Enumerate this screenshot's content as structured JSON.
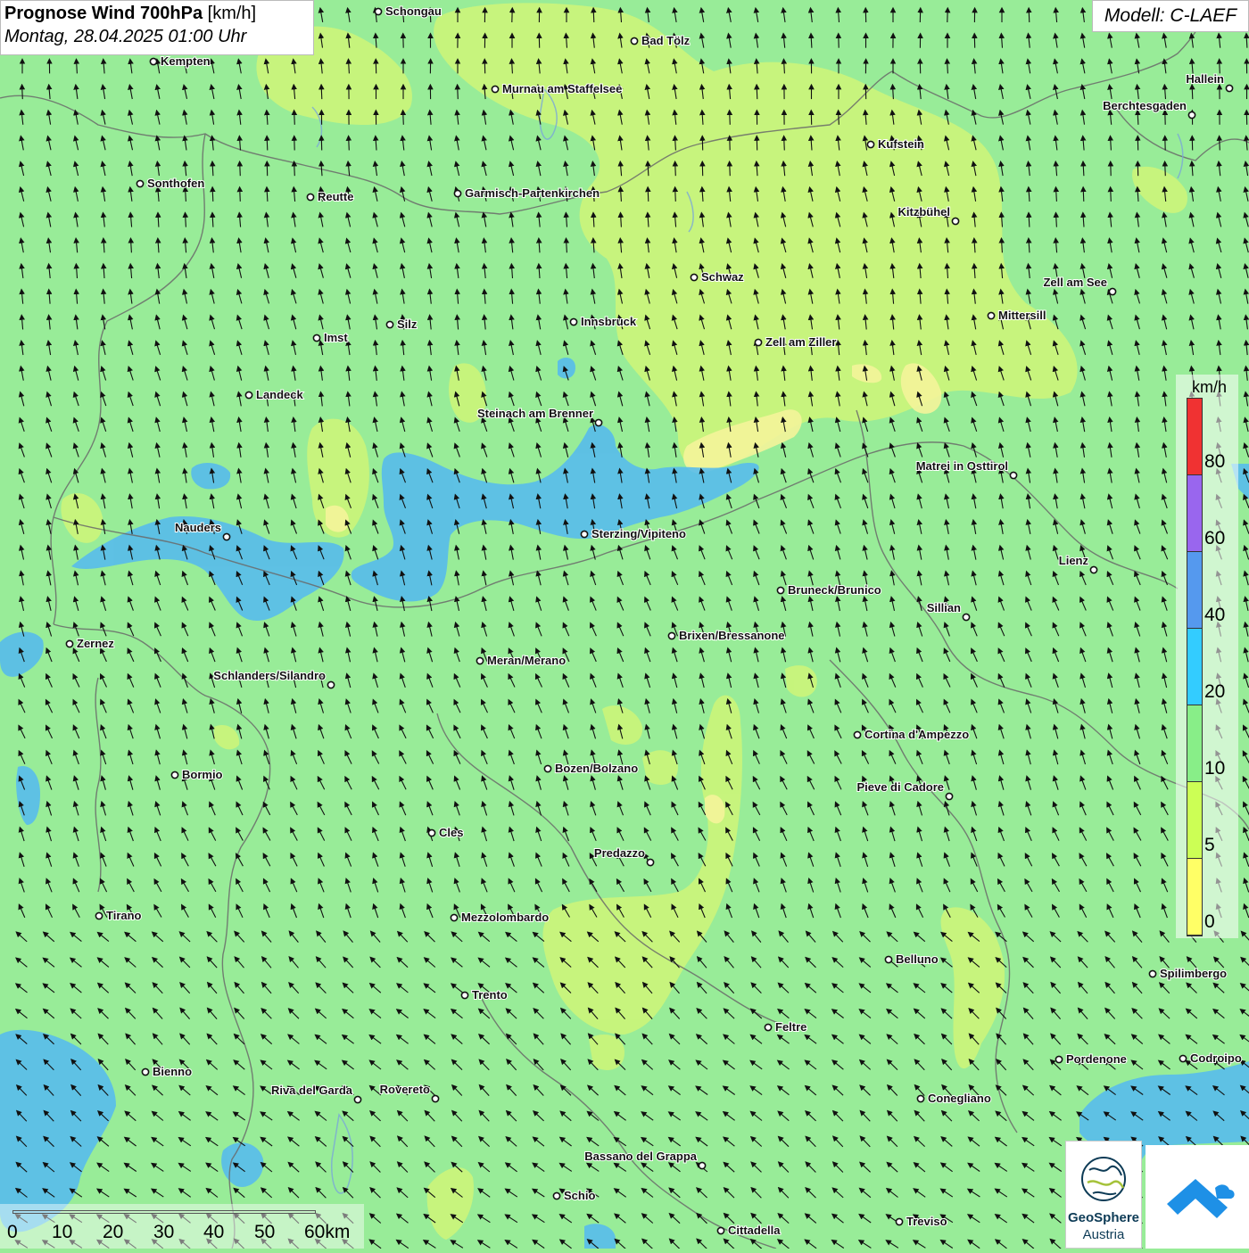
{
  "title": {
    "main": "Prognose Wind 700hPa",
    "unit": "[km/h]",
    "date": "Montag, 28.04.2025 01:00 Uhr"
  },
  "model": "Modell: C-LAEF",
  "legend": {
    "unit": "km/h",
    "levels": [
      {
        "label": "80",
        "color": "#f03232"
      },
      {
        "label": "60",
        "color": "#9966ee"
      },
      {
        "label": "40",
        "color": "#5599ee"
      },
      {
        "label": "20",
        "color": "#33ccff"
      },
      {
        "label": "10",
        "color": "#88ee88"
      },
      {
        "label": "5",
        "color": "#ccff55"
      },
      {
        "label": "0",
        "color": "#ffff66"
      }
    ]
  },
  "scalebar": {
    "labels": [
      "0",
      "10",
      "20",
      "30",
      "40",
      "50",
      "60km"
    ]
  },
  "logos": {
    "geosphere_line1": "GeoSphere",
    "geosphere_line2": "Austria"
  },
  "cities": [
    {
      "name": "Schongau"
    },
    {
      "name": "Bad Tölz"
    },
    {
      "name": "Kempten"
    },
    {
      "name": "Murnau am Staffelsee"
    },
    {
      "name": "Hallein"
    },
    {
      "name": "Berchtesgaden"
    },
    {
      "name": "Kufstein"
    },
    {
      "name": "Sonthofen"
    },
    {
      "name": "Reutte"
    },
    {
      "name": "Garmisch-Partenkirchen"
    },
    {
      "name": "Kitzbühel"
    },
    {
      "name": "Schwaz"
    },
    {
      "name": "Zell am See"
    },
    {
      "name": "Mittersill"
    },
    {
      "name": "Silz"
    },
    {
      "name": "Innsbruck"
    },
    {
      "name": "Imst"
    },
    {
      "name": "Zell am Ziller"
    },
    {
      "name": "Landeck"
    },
    {
      "name": "Steinach am Brenner"
    },
    {
      "name": "Matrei in Osttirol"
    },
    {
      "name": "Nauders"
    },
    {
      "name": "Sterzing/Vipiteno"
    },
    {
      "name": "Lienz"
    },
    {
      "name": "Bruneck/Brunico"
    },
    {
      "name": "Sillian"
    },
    {
      "name": "Zernez"
    },
    {
      "name": "Brixen/Bressanone"
    },
    {
      "name": "Meran/Merano"
    },
    {
      "name": "Schlanders/Silandro"
    },
    {
      "name": "Cortina d'Ampezzo"
    },
    {
      "name": "Bozen/Bolzano"
    },
    {
      "name": "Bormio"
    },
    {
      "name": "Pieve di Cadore"
    },
    {
      "name": "Cles"
    },
    {
      "name": "Predazzo"
    },
    {
      "name": "Tirano"
    },
    {
      "name": "Mezzolombardo"
    },
    {
      "name": "Belluno"
    },
    {
      "name": "Spilimbergo"
    },
    {
      "name": "Trento"
    },
    {
      "name": "Feltre"
    },
    {
      "name": "Pordenone"
    },
    {
      "name": "Codroipo"
    },
    {
      "name": "Bienno"
    },
    {
      "name": "Riva del Garda"
    },
    {
      "name": "Rovereto"
    },
    {
      "name": "Conegliano"
    },
    {
      "name": "Bassano del Grappa"
    },
    {
      "name": "Schio"
    },
    {
      "name": "Treviso"
    },
    {
      "name": "Cittadella"
    }
  ]
}
